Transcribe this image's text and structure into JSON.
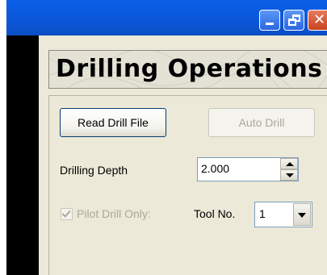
{
  "window": {
    "title_buttons": {
      "minimize_icon": "minimize-icon",
      "restore_icon": "restore-icon",
      "close_icon": "close-icon"
    }
  },
  "banner": {
    "title": "Drilling Operations"
  },
  "buttons": {
    "read_drill_file": "Read Drill File",
    "auto_drill": "Auto Drill"
  },
  "depth": {
    "label": "Drilling Depth",
    "value": "2.000"
  },
  "pilot": {
    "label": "Pilot Drill Only:",
    "checked": true,
    "enabled": false
  },
  "tool": {
    "label": "Tool No.",
    "value": "1"
  },
  "colors": {
    "titlebar": "#0b56d8",
    "face": "#ece9d8",
    "disabled_text": "#aca899"
  }
}
